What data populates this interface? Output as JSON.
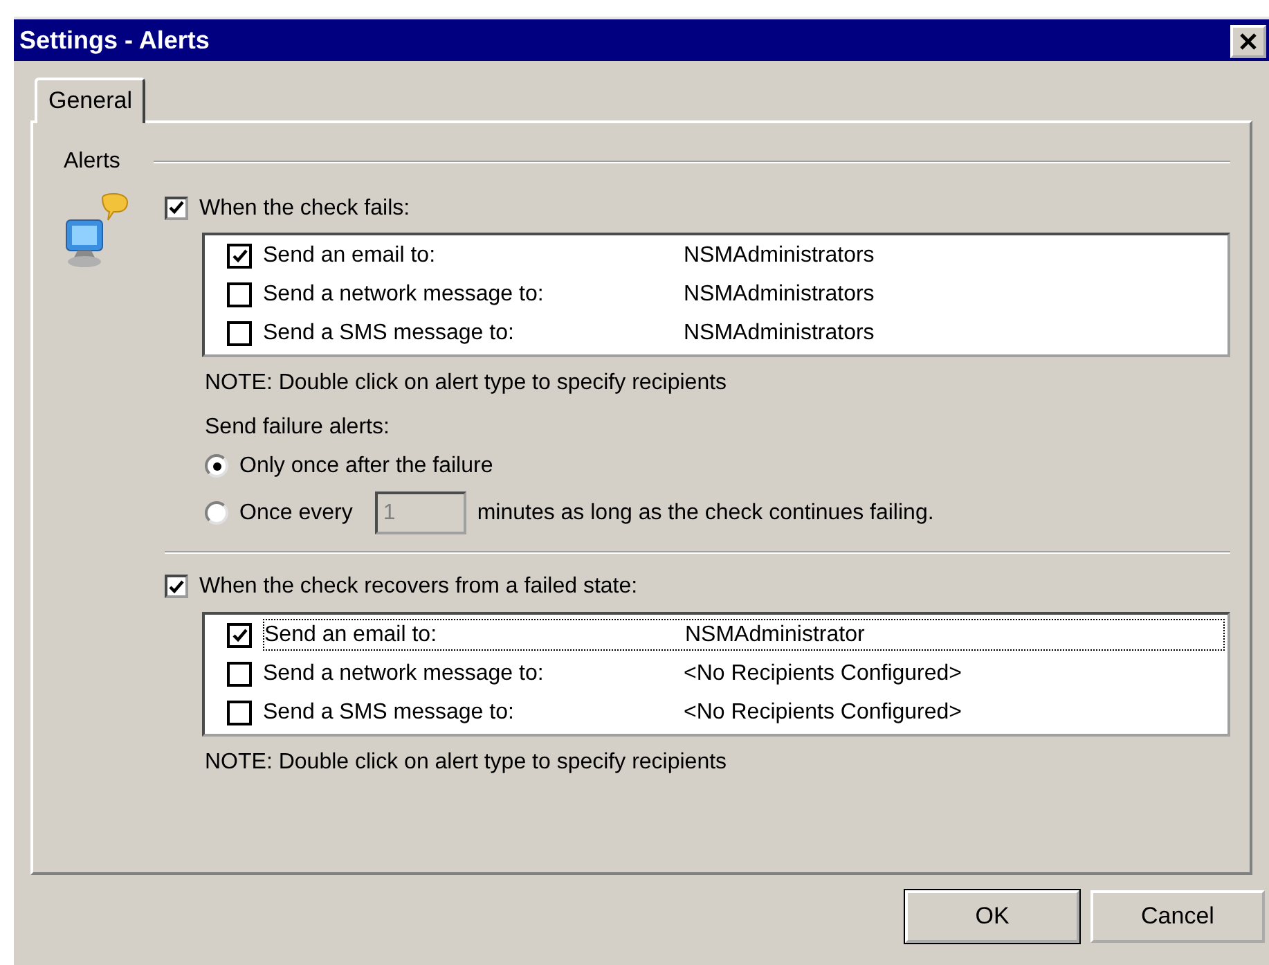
{
  "window": {
    "title": "Settings - Alerts"
  },
  "tabs": [
    {
      "label": "General",
      "selected": true
    }
  ],
  "group": {
    "label": "Alerts"
  },
  "sections": [
    {
      "label": "When the check fails:",
      "checked": true,
      "alerts": [
        {
          "label": "Send an email to:",
          "recipient": "NSMAdministrators",
          "checked": true,
          "focused": false
        },
        {
          "label": "Send a network message to:",
          "recipient": "NSMAdministrators",
          "checked": false,
          "focused": false
        },
        {
          "label": "Send a SMS message to:",
          "recipient": "NSMAdministrators",
          "checked": false,
          "focused": false
        }
      ],
      "note": "NOTE: Double click on alert type to specify recipients",
      "frequency": {
        "label": "Send failure alerts:",
        "options": [
          {
            "kind": "plain",
            "label": "Only once after the failure",
            "selected": true
          },
          {
            "kind": "interval",
            "label": "Once every",
            "value": "1",
            "suffix": "minutes as long as the check continues failing.",
            "selected": false,
            "disabled": true
          }
        ]
      }
    },
    {
      "label": "When the check recovers from a failed state:",
      "checked": true,
      "alerts": [
        {
          "label": "Send an email to:",
          "recipient": "NSMAdministrator",
          "checked": true,
          "focused": true
        },
        {
          "label": "Send a network message to:",
          "recipient": "<No Recipients Configured>",
          "checked": false,
          "focused": false
        },
        {
          "label": "Send a SMS message to:",
          "recipient": "<No Recipients Configured>",
          "checked": false,
          "focused": false
        }
      ],
      "note": "NOTE: Double click on alert type to specify recipients"
    }
  ],
  "buttons": [
    {
      "label": "OK",
      "default": true
    },
    {
      "label": "Cancel",
      "default": false
    }
  ]
}
